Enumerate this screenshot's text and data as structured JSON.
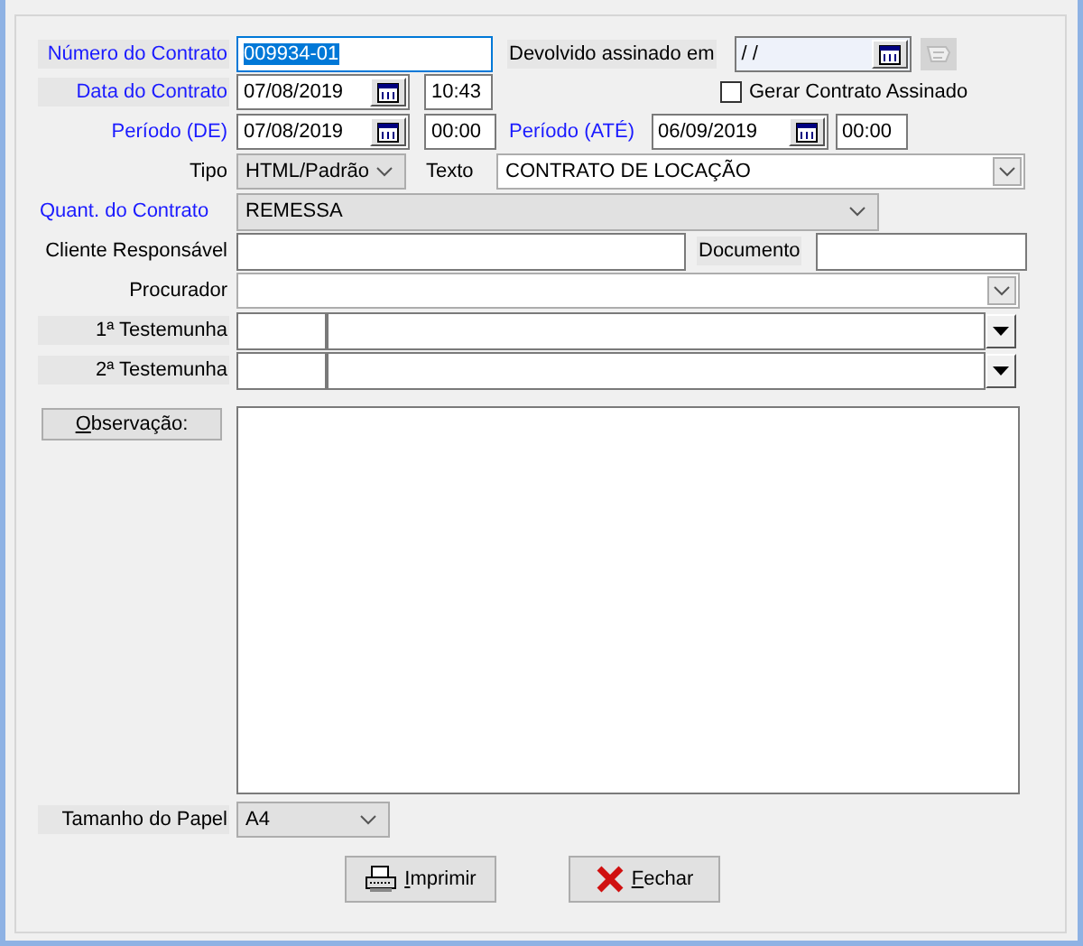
{
  "contract_number": {
    "label": "Número do Contrato",
    "required": true,
    "value": "009934-01",
    "text_selected": true,
    "focused": true
  },
  "returned_signed": {
    "label": "Devolvido assinado em",
    "required": false,
    "value": " /  /"
  },
  "contract_date": {
    "label": "Data do Contrato",
    "required": true,
    "date": "07/08/2019",
    "time": "10:43"
  },
  "generate_signed": {
    "label": "Gerar Contrato Assinado",
    "checked": false
  },
  "period_from": {
    "label": "Período (DE)",
    "required": true,
    "date": "07/08/2019",
    "time": "00:00"
  },
  "period_to": {
    "label": "Período (ATÉ)",
    "required": true,
    "date": "06/09/2019",
    "time": "00:00"
  },
  "type": {
    "label": "Tipo",
    "required": false,
    "value": "HTML/Padrão"
  },
  "text": {
    "label": "Texto",
    "required": false,
    "value": "CONTRATO DE LOCAÇÃO"
  },
  "quantity": {
    "label": "Quant. do Contrato",
    "required": true,
    "value": "REMESSA"
  },
  "client": {
    "label": "Cliente Responsável",
    "required": false
  },
  "document": {
    "label": "Documento",
    "required": false
  },
  "attorney": {
    "label": "Procurador",
    "required": false
  },
  "witnesses": [
    {
      "label": "1ª Testemunha"
    },
    {
      "label": "2ª Testemunha"
    }
  ],
  "notes_button": {
    "label": "Observação:",
    "mnemonic_underlined": true
  },
  "paper_size": {
    "label": "Tamanho do Papel",
    "required": false,
    "value": "A4"
  },
  "buttons": [
    {
      "kind": "print",
      "label": "Imprimir",
      "mnemonic_underlined": true
    },
    {
      "kind": "close",
      "label": "Fechar",
      "mnemonic_underlined": true
    }
  ]
}
